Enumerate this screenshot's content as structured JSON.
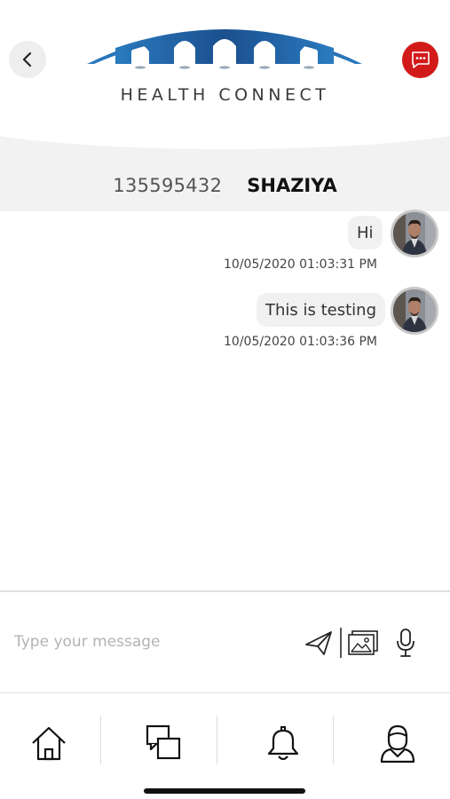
{
  "header": {
    "brand": "HEALTH CONNECT",
    "back_icon": "chevron-left-icon",
    "menu_icon": "chat-bubble-dots-icon",
    "accent_color": "#d21a1a",
    "logo_color": "#1f5fa0"
  },
  "contact": {
    "id": "135595432",
    "name": "SHAZIYA"
  },
  "messages": [
    {
      "text": "Hi",
      "timestamp": "10/05/2020 01:03:31 PM"
    },
    {
      "text": "This is testing",
      "timestamp": "10/05/2020 01:03:36 PM"
    }
  ],
  "composer": {
    "placeholder": "Type your message",
    "value": "",
    "send_icon": "send-icon",
    "gallery_icon": "gallery-icon",
    "mic_icon": "microphone-icon"
  },
  "nav": [
    {
      "icon": "home-icon"
    },
    {
      "icon": "messages-icon"
    },
    {
      "icon": "bell-icon"
    },
    {
      "icon": "profile-icon"
    }
  ]
}
